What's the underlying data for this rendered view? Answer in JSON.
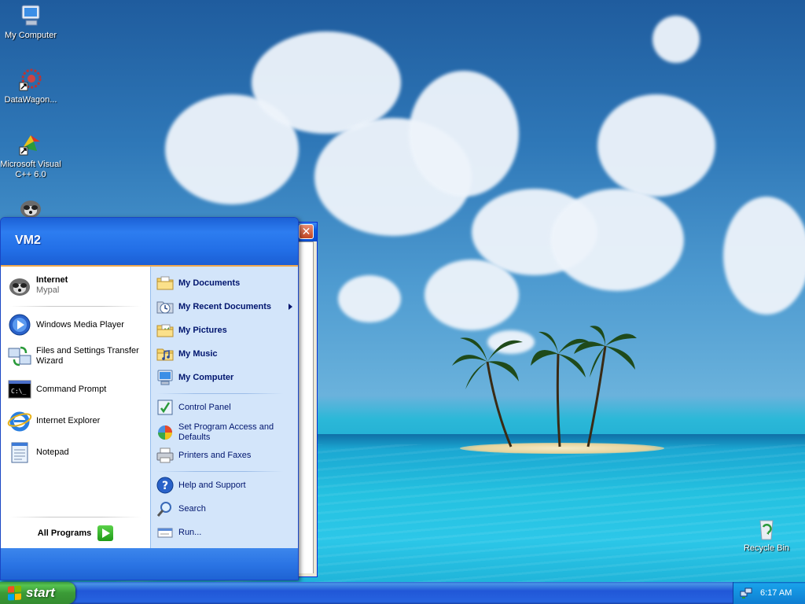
{
  "desktop": {
    "icons": [
      {
        "label": "My Computer"
      },
      {
        "label": "DataWagon..."
      },
      {
        "label": "Microsoft Visual C++ 6.0"
      },
      {
        "label": ""
      },
      {
        "label": "Recycle Bin"
      }
    ]
  },
  "start_menu": {
    "username": "VM2",
    "pinned": [
      {
        "title": "Internet",
        "subtitle": "Mypal"
      }
    ],
    "recent": [
      {
        "label": "Windows Media Player"
      },
      {
        "label": "Files and Settings Transfer Wizard"
      },
      {
        "label": "Command Prompt"
      },
      {
        "label": "Internet Explorer"
      },
      {
        "label": "Notepad"
      }
    ],
    "all_programs_label": "All Programs",
    "places": [
      {
        "label": "My Documents"
      },
      {
        "label": "My Recent Documents"
      },
      {
        "label": "My Pictures"
      },
      {
        "label": "My Music"
      },
      {
        "label": "My Computer"
      }
    ],
    "system": [
      {
        "label": "Control Panel"
      },
      {
        "label": "Set Program Access and Defaults"
      },
      {
        "label": "Printers and Faxes"
      }
    ],
    "help": [
      {
        "label": "Help and Support"
      },
      {
        "label": "Search"
      },
      {
        "label": "Run..."
      }
    ]
  },
  "background_window": {
    "close_glyph": "✕"
  },
  "taskbar": {
    "start_label": "start",
    "clock": "6:17 AM"
  },
  "colors": {
    "taskbar_blue": "#245edb",
    "start_green": "#3b9b37",
    "menu_right_pane": "#d3e5fa",
    "menu_link_text": "#00156e"
  }
}
